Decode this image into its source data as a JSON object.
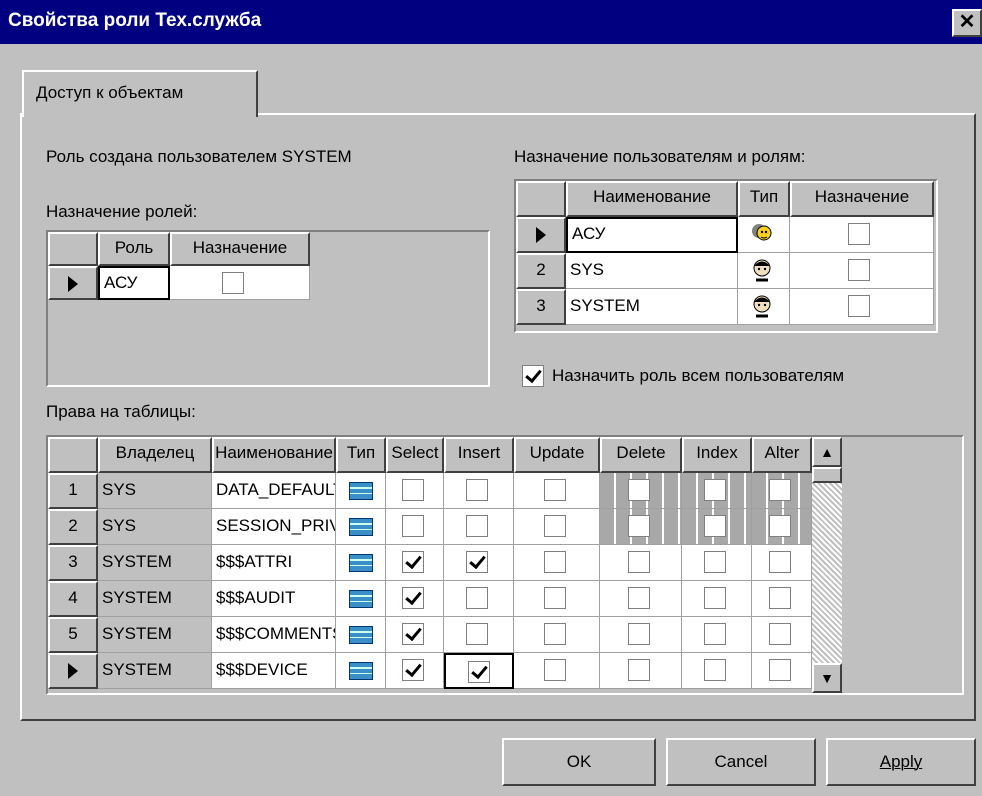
{
  "window": {
    "title": "Свойства роли Тех.служба",
    "close_glyph": "✕"
  },
  "tabs": [
    {
      "label": "Доступ к объектам"
    }
  ],
  "role_created_by": "Роль создана пользователем SYSTEM",
  "role_assignment": {
    "label": "Назначение ролей:",
    "columns": [
      "Роль",
      "Назначение"
    ],
    "rows": [
      {
        "role": "АСУ",
        "assigned": false,
        "current": true
      }
    ]
  },
  "user_assignment": {
    "label": "Назначение пользователям и ролям:",
    "columns": [
      "Наименование",
      "Тип",
      "Назначение"
    ],
    "rows": [
      {
        "num": "",
        "name": "АСУ",
        "type_icon": "role-icon",
        "assigned": false,
        "current": true
      },
      {
        "num": "2",
        "name": "SYS",
        "type_icon": "user-icon",
        "assigned": false,
        "current": false
      },
      {
        "num": "3",
        "name": "SYSTEM",
        "type_icon": "user-icon",
        "assigned": false,
        "current": false
      }
    ]
  },
  "assign_all": {
    "label": "Назначить роль всем пользователям",
    "checked": true
  },
  "table_rights": {
    "label": "Права на таблицы:",
    "columns": [
      "Владелец",
      "Наименование",
      "Тип",
      "Select",
      "Insert",
      "Update",
      "Delete",
      "Index",
      "Alter"
    ],
    "rows": [
      {
        "num": "1",
        "owner": "SYS",
        "name": "DATA_DEFAULT",
        "type_icon": "table-icon",
        "select": false,
        "insert": false,
        "update": false,
        "delete": false,
        "index": false,
        "alter": false,
        "grayed": true
      },
      {
        "num": "2",
        "owner": "SYS",
        "name": "SESSION_PRIVS",
        "type_icon": "table-icon",
        "select": false,
        "insert": false,
        "update": false,
        "delete": false,
        "index": false,
        "alter": false,
        "grayed": true
      },
      {
        "num": "3",
        "owner": "SYSTEM",
        "name": "$$$ATTRI",
        "type_icon": "table-icon",
        "select": true,
        "insert": true,
        "update": false,
        "delete": false,
        "index": false,
        "alter": false,
        "grayed": false
      },
      {
        "num": "4",
        "owner": "SYSTEM",
        "name": "$$$AUDIT",
        "type_icon": "table-icon",
        "select": true,
        "insert": false,
        "update": false,
        "delete": false,
        "index": false,
        "alter": false,
        "grayed": false
      },
      {
        "num": "5",
        "owner": "SYSTEM",
        "name": "$$$COMMENTS",
        "type_icon": "table-icon",
        "select": true,
        "insert": false,
        "update": false,
        "delete": false,
        "index": false,
        "alter": false,
        "grayed": false
      },
      {
        "num": "",
        "owner": "SYSTEM",
        "name": "$$$DEVICE",
        "type_icon": "table-icon",
        "select": true,
        "insert": true,
        "update": false,
        "delete": false,
        "index": false,
        "alter": false,
        "grayed": false,
        "current": true
      }
    ]
  },
  "buttons": {
    "ok": "OK",
    "cancel": "Cancel",
    "apply": "Apply"
  },
  "colors": {
    "titlebar": "#000080",
    "face": "#c0c0c0",
    "grid_gray": "#a0a0a0"
  }
}
